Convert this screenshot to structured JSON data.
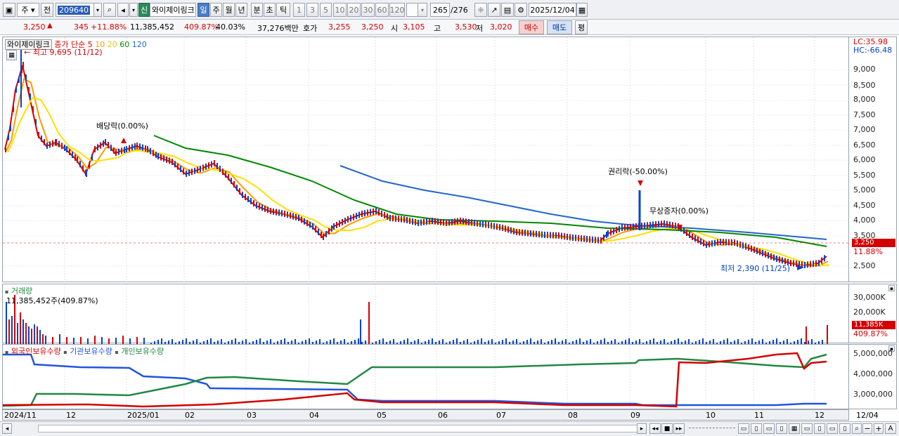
{
  "toolbar": {
    "period_selector": "주",
    "prev_label": "전",
    "code_input": "209640",
    "new_badge": "신",
    "stock_name": "와이제이링크",
    "period_tabs": [
      "일",
      "주",
      "월",
      "년",
      "분",
      "초",
      "틱"
    ],
    "selected_tab": "일",
    "interval_buttons": [
      "1",
      "3",
      "5",
      "10",
      "20",
      "30",
      "60",
      "120"
    ],
    "count_value": "265",
    "count_total": "/276",
    "date_value": "2025/12/04"
  },
  "quote": {
    "price": "3,250",
    "change": "345",
    "change_pct": "+11.88%",
    "volume": "11,385,452",
    "volume_ratio": "409.87%",
    "turnover": "40.03%",
    "amount": "37,276백만",
    "bid_label": "호가",
    "bid": "3,255",
    "ask": "3,250",
    "open_label": "시",
    "open": "3,105",
    "high_label": "고",
    "high": "3,530",
    "low_label": "저",
    "low": "3,020",
    "buy_button": "매수",
    "sell_button": "매도",
    "avg_button": "평"
  },
  "price_panel": {
    "title": "와이제이링크",
    "ma_legend_label": "종가 단순",
    "ma_periods": [
      {
        "label": "5",
        "color": "#d40000"
      },
      {
        "label": "10",
        "color": "#ff9900"
      },
      {
        "label": "20",
        "color": "#ffe000"
      },
      {
        "label": "60",
        "color": "#008800"
      },
      {
        "label": "120",
        "color": "#2266cc"
      }
    ],
    "max_note": "최고 9,695 (11/12)",
    "min_note": "최저 2,390 (11/25)",
    "events": [
      "배당락(0.00%)",
      "권리락(-50.00%)",
      "무상증자(0.00%)"
    ],
    "lc_label": "LC:35.98",
    "hc_label": "HC:-66.48",
    "y_ticks": [
      "9,000",
      "8,500",
      "8,000",
      "7,500",
      "7,000",
      "6,500",
      "6,000",
      "5,500",
      "5,000",
      "4,500",
      "4,000",
      "3,500",
      "2,500"
    ],
    "current_tag": "3,250",
    "current_pct": "11.88%"
  },
  "volume_panel": {
    "title": "거래량",
    "value_note": "11,385,452주(409.87%)",
    "y_ticks": [
      "30,000K",
      "20,000K",
      "10,000K"
    ],
    "current_tag": "11,385K",
    "current_pct": "409.87%"
  },
  "holdings_panel": {
    "legends": [
      {
        "label": "외국인보유수량",
        "color": "#d40000"
      },
      {
        "label": "기관보유수량",
        "color": "#2255dd"
      },
      {
        "label": "개인보유수량",
        "color": "#228844"
      }
    ],
    "y_ticks": [
      "5,000,000",
      "4,000,000",
      "3,000,000"
    ]
  },
  "x_axis": {
    "labels": [
      "2024/11",
      "12",
      "2025/01",
      "02",
      "03",
      "04",
      "05",
      "06",
      "07",
      "08",
      "09",
      "10",
      "11",
      "12"
    ],
    "right_label": "12/04"
  },
  "colors": {
    "up": "#d40000",
    "down": "#0044cc",
    "ma5": "#d40000",
    "ma10": "#ff9900",
    "ma20": "#ffe000",
    "ma60": "#008800",
    "ma120": "#2266cc"
  }
}
